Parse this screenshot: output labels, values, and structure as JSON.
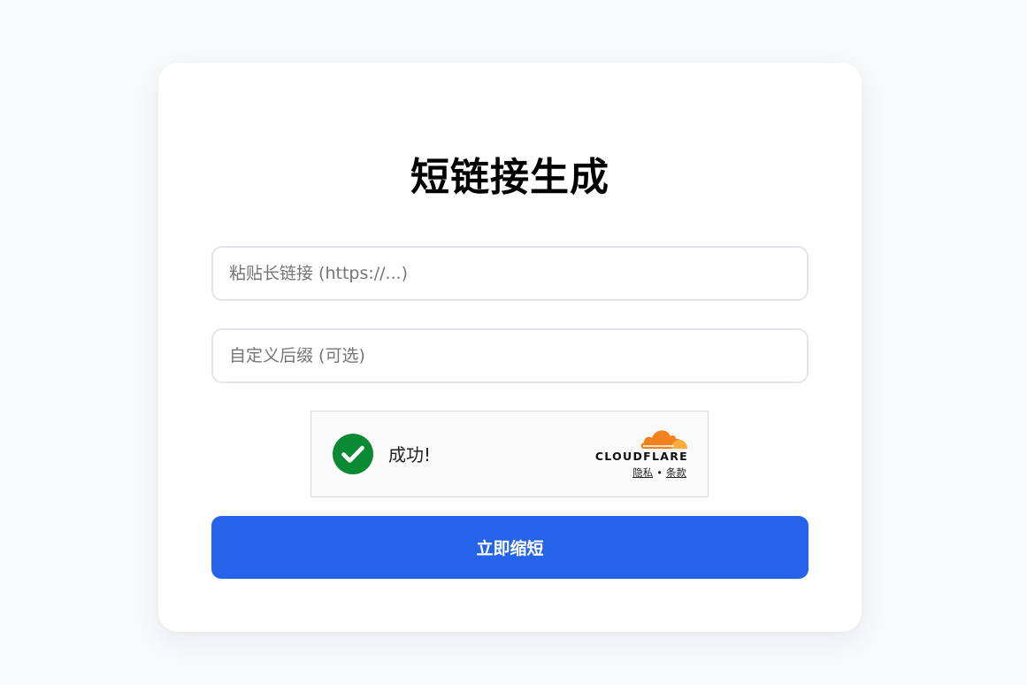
{
  "page": {
    "title": "短链接生成"
  },
  "form": {
    "url_placeholder": "粘贴长链接 (https://...)",
    "url_value": "",
    "suffix_placeholder": "自定义后缀 (可选)",
    "suffix_value": "",
    "submit_label": "立即缩短"
  },
  "captcha": {
    "status_text": "成功!",
    "status_icon": "check-circle-icon",
    "brand": "CLOUDFLARE",
    "brand_icon": "cloudflare-cloud-icon",
    "privacy_link": "隐私",
    "separator": "•",
    "terms_link": "条款"
  },
  "colors": {
    "background": "#f8f9fb",
    "card": "#ffffff",
    "accent": "#2563eb",
    "success": "#0b8a34",
    "cloudflare_orange": "#f48120",
    "cloudflare_light_orange": "#faad3f"
  }
}
